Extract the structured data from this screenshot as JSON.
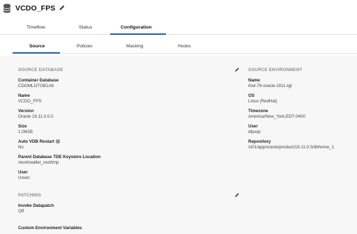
{
  "header": {
    "title": "VCDO_FPS"
  },
  "tabs": [
    "Timeflow",
    "Status",
    "Configuration"
  ],
  "subtabs": [
    "Source",
    "Policies",
    "Masking",
    "Hooks"
  ],
  "source_database": {
    "title": "SOURCE DATABASE",
    "fields": [
      {
        "label": "Container Database",
        "value": "CDOMLOTGB1A6"
      },
      {
        "label": "Name",
        "value": "VCDO_FPS"
      },
      {
        "label": "Version",
        "value": "Oracle 19.11.0.0.0"
      },
      {
        "label": "Size",
        "value": "1.06GB"
      },
      {
        "label": "Auto VDB Restart",
        "value": "No"
      },
      {
        "label": "Parent Database TDE Keystore Location",
        "value": "/work/wallet_root/tmp"
      },
      {
        "label": "User",
        "value": "Unset"
      }
    ]
  },
  "source_environment": {
    "title": "SOURCE ENVIRONMENT",
    "fields": [
      {
        "label": "Name",
        "value": "rhel-79-oracle-1911-tgt"
      },
      {
        "label": "OS",
        "value": "Linux (RedHat)"
      },
      {
        "label": "Timezone",
        "value": "America/New_York,EDT-0400"
      },
      {
        "label": "User",
        "value": "dlpxqs"
      },
      {
        "label": "Repository",
        "value": "/u01/app/oracle/product/19.11.0.0/dbhome_1"
      }
    ]
  },
  "patching": {
    "title": "PATCHING",
    "fields": [
      {
        "label": "Invoke Datapatch",
        "value": "Off"
      }
    ]
  },
  "custom_env": {
    "label": "Custom Environment Variables"
  }
}
